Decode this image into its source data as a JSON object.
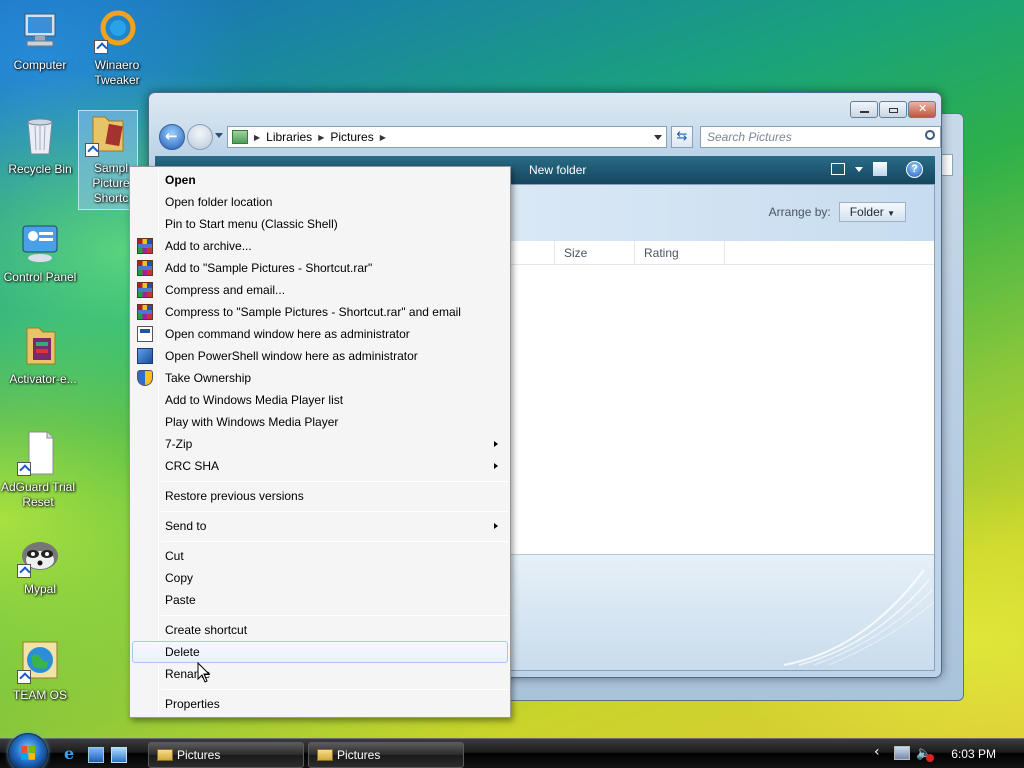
{
  "desktop": {
    "icons": [
      {
        "label": "Computer",
        "icon": "computer-icon"
      },
      {
        "label": "Winaero Tweaker",
        "icon": "winaero-icon"
      },
      {
        "label": "Recycle Bin",
        "icon": "recycle-bin-icon"
      },
      {
        "label": "Sample Pictures - Shortcut",
        "icon": "folder-shortcut-icon",
        "visible_label": "Sampl Picture Shortc"
      },
      {
        "label": "Control Panel",
        "icon": "control-panel-icon"
      },
      {
        "label": "Activator-e...",
        "icon": "folder-icon"
      },
      {
        "label": "AdGuard Trial Reset",
        "icon": "document-shortcut-icon"
      },
      {
        "label": "Mypal",
        "icon": "raccoon-icon"
      },
      {
        "label": "TEAM OS",
        "icon": "globe-shortcut-icon"
      }
    ]
  },
  "explorer": {
    "breadcrumb": [
      "Libraries",
      "Pictures"
    ],
    "search_placeholder": "Search Pictures",
    "toolbar_new_folder": "New folder",
    "arrange_by_label": "Arrange by:",
    "arrange_by_value": "Folder",
    "columns": [
      "Size",
      "Rating"
    ]
  },
  "context_menu": {
    "items": [
      {
        "label": "Open",
        "bold": true
      },
      {
        "label": "Open folder location"
      },
      {
        "label": "Pin to Start menu (Classic Shell)"
      },
      {
        "label": "Add to archive...",
        "icon": "winrar-icon"
      },
      {
        "label": "Add to \"Sample Pictures - Shortcut.rar\"",
        "icon": "winrar-icon"
      },
      {
        "label": "Compress and email...",
        "icon": "winrar-icon"
      },
      {
        "label": "Compress to \"Sample Pictures - Shortcut.rar\" and email",
        "icon": "winrar-icon"
      },
      {
        "label": "Open command window here as administrator",
        "icon": "cmd-icon"
      },
      {
        "label": "Open PowerShell window here as administrator",
        "icon": "powershell-icon"
      },
      {
        "label": "Take Ownership",
        "icon": "uac-shield-icon"
      },
      {
        "label": "Add to Windows Media Player list"
      },
      {
        "label": "Play with Windows Media Player"
      },
      {
        "label": "7-Zip",
        "submenu": true
      },
      {
        "label": "CRC SHA",
        "submenu": true
      },
      {
        "label": "Restore previous versions"
      },
      {
        "label": "Send to",
        "submenu": true
      },
      {
        "label": "Cut"
      },
      {
        "label": "Copy"
      },
      {
        "label": "Paste"
      },
      {
        "label": "Create shortcut"
      },
      {
        "label": "Delete",
        "highlighted": true
      },
      {
        "label": "Rename"
      },
      {
        "label": "Properties"
      }
    ]
  },
  "taskbar": {
    "buttons": [
      "Pictures",
      "Pictures"
    ],
    "clock": "6:03 PM"
  }
}
